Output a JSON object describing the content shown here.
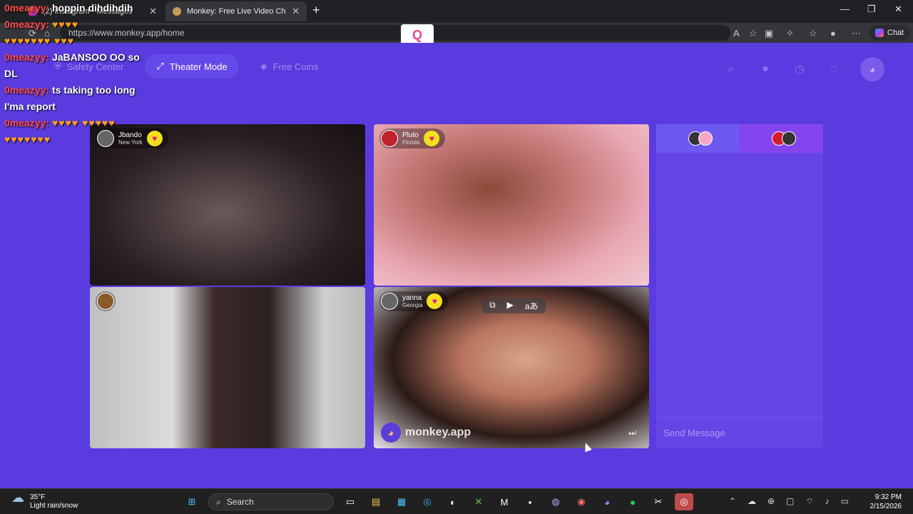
{
  "tabs": [
    {
      "title": "(2) Instagram • Messages"
    },
    {
      "title": "Monkey: Free Live Video Chat"
    }
  ],
  "address": {
    "url": "https://www.monkey.app/home"
  },
  "browser": {
    "chat_label": "Chat"
  },
  "nav": {
    "safety": "Safety Center",
    "theater": "Theater Mode",
    "coins": "Free Coins"
  },
  "tiles": [
    {
      "name": "Jbando",
      "location": "New York"
    },
    {
      "name": "Pluto",
      "location": "Florida"
    },
    {
      "name": "",
      "location": ""
    },
    {
      "name": "yanna",
      "location": "Georgia"
    }
  ],
  "watermark": "monkey.app",
  "send_placeholder": "Send Message",
  "overlay": [
    {
      "user": "0meazyy:",
      "text": "hoppin dihdihdih"
    },
    {
      "user": "0meazyy:",
      "text": ""
    },
    {
      "user": "0meazyy:",
      "text": ""
    },
    {
      "user": "0meazyy:",
      "text": "JaBANSOO OO so DL"
    },
    {
      "user": "0meazyy:",
      "text": "ts taking too long I'ma report"
    },
    {
      "user": "0meazyy:",
      "text": ""
    }
  ],
  "taskbar": {
    "temp": "35°F",
    "weather": "Light rain/snow",
    "search": "Search",
    "time": "9:32 PM",
    "date": "2/15/2026"
  },
  "colors": {
    "page_bg": "#5a3bdf",
    "heart_bg": "#f3e01b",
    "username_color": "#ff4d4d"
  }
}
